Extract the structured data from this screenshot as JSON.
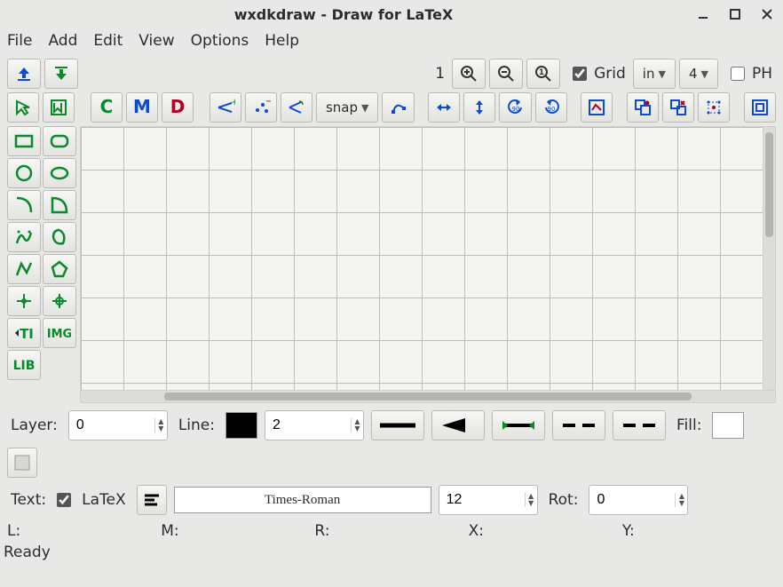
{
  "window": {
    "title": "wxdkdraw - Draw for LaTeX"
  },
  "menu": {
    "file": "File",
    "add": "Add",
    "edit": "Edit",
    "view": "View",
    "options": "Options",
    "help": "Help"
  },
  "top": {
    "zoom_current": "1",
    "grid_label": "Grid",
    "grid_checked": true,
    "unit": "in",
    "grid_step": "4",
    "ph_label": "PH",
    "ph_checked": false,
    "snap_label": "snap"
  },
  "layer_row": {
    "layer_label": "Layer:",
    "layer_value": "0",
    "line_label": "Line:",
    "line_color": "#000000",
    "line_width": "2",
    "fill_label": "Fill:",
    "fill_color": "#ffffff"
  },
  "text_row": {
    "text_label": "Text:",
    "latex_label": "LaTeX",
    "latex_checked": true,
    "font": "Times-Roman",
    "size": "12",
    "rot_label": "Rot:",
    "rot_value": "0"
  },
  "coords": {
    "L": "L:",
    "M": "M:",
    "R": "R:",
    "X": "X:",
    "Y": "Y:"
  },
  "status": "Ready"
}
